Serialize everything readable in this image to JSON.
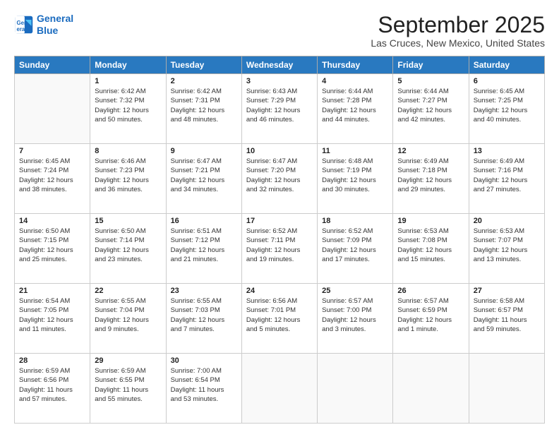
{
  "header": {
    "logo_line1": "General",
    "logo_line2": "Blue",
    "month_title": "September 2025",
    "location": "Las Cruces, New Mexico, United States"
  },
  "weekdays": [
    "Sunday",
    "Monday",
    "Tuesday",
    "Wednesday",
    "Thursday",
    "Friday",
    "Saturday"
  ],
  "weeks": [
    [
      {
        "day": "",
        "sunrise": "",
        "sunset": "",
        "daylight": ""
      },
      {
        "day": "1",
        "sunrise": "Sunrise: 6:42 AM",
        "sunset": "Sunset: 7:32 PM",
        "daylight": "Daylight: 12 hours and 50 minutes."
      },
      {
        "day": "2",
        "sunrise": "Sunrise: 6:42 AM",
        "sunset": "Sunset: 7:31 PM",
        "daylight": "Daylight: 12 hours and 48 minutes."
      },
      {
        "day": "3",
        "sunrise": "Sunrise: 6:43 AM",
        "sunset": "Sunset: 7:29 PM",
        "daylight": "Daylight: 12 hours and 46 minutes."
      },
      {
        "day": "4",
        "sunrise": "Sunrise: 6:44 AM",
        "sunset": "Sunset: 7:28 PM",
        "daylight": "Daylight: 12 hours and 44 minutes."
      },
      {
        "day": "5",
        "sunrise": "Sunrise: 6:44 AM",
        "sunset": "Sunset: 7:27 PM",
        "daylight": "Daylight: 12 hours and 42 minutes."
      },
      {
        "day": "6",
        "sunrise": "Sunrise: 6:45 AM",
        "sunset": "Sunset: 7:25 PM",
        "daylight": "Daylight: 12 hours and 40 minutes."
      }
    ],
    [
      {
        "day": "7",
        "sunrise": "Sunrise: 6:45 AM",
        "sunset": "Sunset: 7:24 PM",
        "daylight": "Daylight: 12 hours and 38 minutes."
      },
      {
        "day": "8",
        "sunrise": "Sunrise: 6:46 AM",
        "sunset": "Sunset: 7:23 PM",
        "daylight": "Daylight: 12 hours and 36 minutes."
      },
      {
        "day": "9",
        "sunrise": "Sunrise: 6:47 AM",
        "sunset": "Sunset: 7:21 PM",
        "daylight": "Daylight: 12 hours and 34 minutes."
      },
      {
        "day": "10",
        "sunrise": "Sunrise: 6:47 AM",
        "sunset": "Sunset: 7:20 PM",
        "daylight": "Daylight: 12 hours and 32 minutes."
      },
      {
        "day": "11",
        "sunrise": "Sunrise: 6:48 AM",
        "sunset": "Sunset: 7:19 PM",
        "daylight": "Daylight: 12 hours and 30 minutes."
      },
      {
        "day": "12",
        "sunrise": "Sunrise: 6:49 AM",
        "sunset": "Sunset: 7:18 PM",
        "daylight": "Daylight: 12 hours and 29 minutes."
      },
      {
        "day": "13",
        "sunrise": "Sunrise: 6:49 AM",
        "sunset": "Sunset: 7:16 PM",
        "daylight": "Daylight: 12 hours and 27 minutes."
      }
    ],
    [
      {
        "day": "14",
        "sunrise": "Sunrise: 6:50 AM",
        "sunset": "Sunset: 7:15 PM",
        "daylight": "Daylight: 12 hours and 25 minutes."
      },
      {
        "day": "15",
        "sunrise": "Sunrise: 6:50 AM",
        "sunset": "Sunset: 7:14 PM",
        "daylight": "Daylight: 12 hours and 23 minutes."
      },
      {
        "day": "16",
        "sunrise": "Sunrise: 6:51 AM",
        "sunset": "Sunset: 7:12 PM",
        "daylight": "Daylight: 12 hours and 21 minutes."
      },
      {
        "day": "17",
        "sunrise": "Sunrise: 6:52 AM",
        "sunset": "Sunset: 7:11 PM",
        "daylight": "Daylight: 12 hours and 19 minutes."
      },
      {
        "day": "18",
        "sunrise": "Sunrise: 6:52 AM",
        "sunset": "Sunset: 7:09 PM",
        "daylight": "Daylight: 12 hours and 17 minutes."
      },
      {
        "day": "19",
        "sunrise": "Sunrise: 6:53 AM",
        "sunset": "Sunset: 7:08 PM",
        "daylight": "Daylight: 12 hours and 15 minutes."
      },
      {
        "day": "20",
        "sunrise": "Sunrise: 6:53 AM",
        "sunset": "Sunset: 7:07 PM",
        "daylight": "Daylight: 12 hours and 13 minutes."
      }
    ],
    [
      {
        "day": "21",
        "sunrise": "Sunrise: 6:54 AM",
        "sunset": "Sunset: 7:05 PM",
        "daylight": "Daylight: 12 hours and 11 minutes."
      },
      {
        "day": "22",
        "sunrise": "Sunrise: 6:55 AM",
        "sunset": "Sunset: 7:04 PM",
        "daylight": "Daylight: 12 hours and 9 minutes."
      },
      {
        "day": "23",
        "sunrise": "Sunrise: 6:55 AM",
        "sunset": "Sunset: 7:03 PM",
        "daylight": "Daylight: 12 hours and 7 minutes."
      },
      {
        "day": "24",
        "sunrise": "Sunrise: 6:56 AM",
        "sunset": "Sunset: 7:01 PM",
        "daylight": "Daylight: 12 hours and 5 minutes."
      },
      {
        "day": "25",
        "sunrise": "Sunrise: 6:57 AM",
        "sunset": "Sunset: 7:00 PM",
        "daylight": "Daylight: 12 hours and 3 minutes."
      },
      {
        "day": "26",
        "sunrise": "Sunrise: 6:57 AM",
        "sunset": "Sunset: 6:59 PM",
        "daylight": "Daylight: 12 hours and 1 minute."
      },
      {
        "day": "27",
        "sunrise": "Sunrise: 6:58 AM",
        "sunset": "Sunset: 6:57 PM",
        "daylight": "Daylight: 11 hours and 59 minutes."
      }
    ],
    [
      {
        "day": "28",
        "sunrise": "Sunrise: 6:59 AM",
        "sunset": "Sunset: 6:56 PM",
        "daylight": "Daylight: 11 hours and 57 minutes."
      },
      {
        "day": "29",
        "sunrise": "Sunrise: 6:59 AM",
        "sunset": "Sunset: 6:55 PM",
        "daylight": "Daylight: 11 hours and 55 minutes."
      },
      {
        "day": "30",
        "sunrise": "Sunrise: 7:00 AM",
        "sunset": "Sunset: 6:54 PM",
        "daylight": "Daylight: 11 hours and 53 minutes."
      },
      {
        "day": "",
        "sunrise": "",
        "sunset": "",
        "daylight": ""
      },
      {
        "day": "",
        "sunrise": "",
        "sunset": "",
        "daylight": ""
      },
      {
        "day": "",
        "sunrise": "",
        "sunset": "",
        "daylight": ""
      },
      {
        "day": "",
        "sunrise": "",
        "sunset": "",
        "daylight": ""
      }
    ]
  ]
}
